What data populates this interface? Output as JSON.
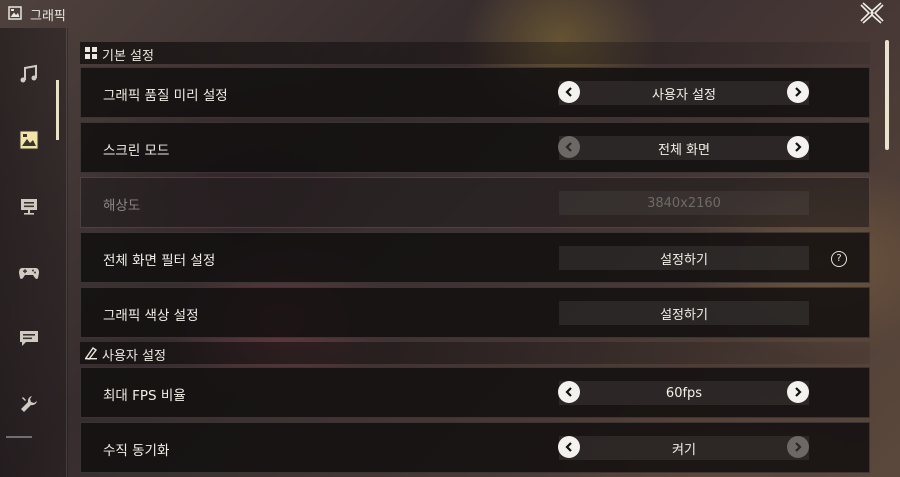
{
  "window": {
    "title": "그래픽"
  },
  "sidebar": {
    "items": [
      {
        "icon": "music-icon",
        "active": false
      },
      {
        "icon": "graphics-icon",
        "active": true
      },
      {
        "icon": "display-icon",
        "active": false
      },
      {
        "icon": "gamepad-icon",
        "active": false
      },
      {
        "icon": "chat-icon",
        "active": false
      },
      {
        "icon": "wrench-icon",
        "active": false
      }
    ]
  },
  "sections": {
    "basic": {
      "title": "기본 설정"
    },
    "custom": {
      "title": "사용자 설정"
    }
  },
  "rows": {
    "quality_preset": {
      "label": "그래픽 품질 미리 설정",
      "value": "사용자 설정"
    },
    "screen_mode": {
      "label": "스크린 모드",
      "value": "전체 화면"
    },
    "resolution": {
      "label": "해상도",
      "value": "3840x2160"
    },
    "fullscreen_filter": {
      "label": "전체 화면 필터 설정",
      "value": "설정하기",
      "help": "?"
    },
    "color_settings": {
      "label": "그래픽 색상 설정",
      "value": "설정하기"
    },
    "max_fps": {
      "label": "최대 FPS 비율",
      "value": "60fps"
    },
    "vsync": {
      "label": "수직 동기화",
      "value": "켜기"
    }
  },
  "colors": {
    "accent": "#e9e3cf",
    "row_bg": "#121010",
    "arrow_active": "#f4f2ee",
    "arrow_disabled": "#6c6866"
  }
}
